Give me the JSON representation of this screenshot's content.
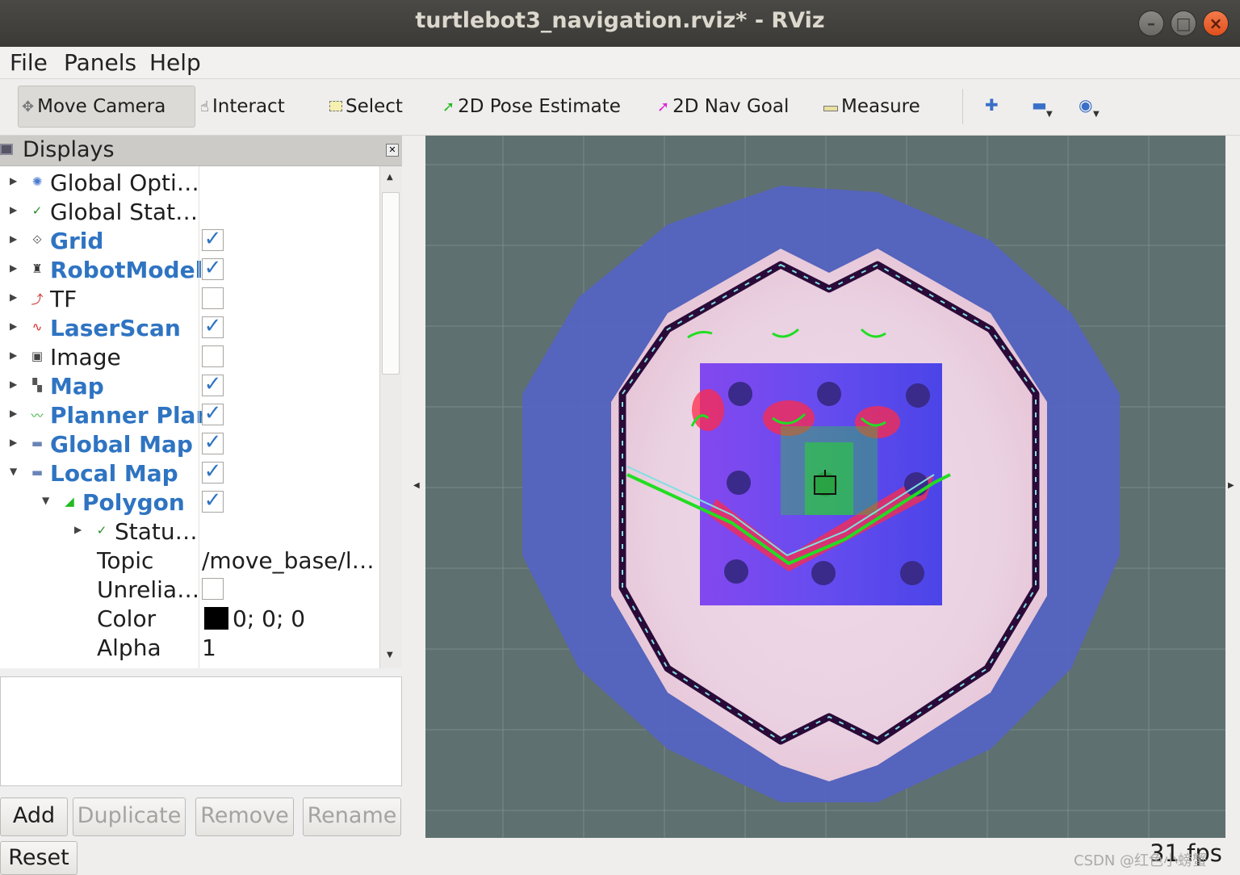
{
  "window": {
    "title": "turtlebot3_navigation.rviz* - RViz"
  },
  "menubar": {
    "file": "File",
    "panels": "Panels",
    "help": "Help"
  },
  "toolbar": {
    "move_camera": "Move Camera",
    "interact": "Interact",
    "select": "Select",
    "pose_estimate": "2D Pose Estimate",
    "nav_goal": "2D Nav Goal",
    "measure": "Measure"
  },
  "displays": {
    "title": "Displays",
    "items": [
      {
        "label": "Global Opti…",
        "icon": "gear-icon",
        "checked": null
      },
      {
        "label": "Global Stat…",
        "icon": "check-icon",
        "checked": null
      },
      {
        "label": "Grid",
        "icon": "grid-icon",
        "checked": true
      },
      {
        "label": "RobotModel",
        "icon": "robot-icon",
        "checked": true
      },
      {
        "label": "TF",
        "icon": "axes-icon",
        "checked": false
      },
      {
        "label": "LaserScan",
        "icon": "laser-icon",
        "checked": true
      },
      {
        "label": "Image",
        "icon": "image-icon",
        "checked": false
      },
      {
        "label": "Map",
        "icon": "map-icon",
        "checked": true
      },
      {
        "label": "Planner Plan",
        "icon": "path-icon",
        "checked": true
      },
      {
        "label": "Global Map",
        "icon": "folder-icon",
        "checked": true
      },
      {
        "label": "Local Map",
        "icon": "folder-icon",
        "checked": true
      },
      {
        "label": "Polygon",
        "icon": "polygon-icon",
        "checked": true
      }
    ],
    "polygon_props": {
      "status": "Statu…",
      "topic_label": "Topic",
      "topic_value": "/move_base/l…",
      "unreliable_label": "Unrelia…",
      "color_label": "Color",
      "color_value": "0; 0; 0",
      "alpha_label": "Alpha",
      "alpha_value": "1"
    }
  },
  "buttons": {
    "add": "Add",
    "duplicate": "Duplicate",
    "remove": "Remove",
    "rename": "Rename",
    "reset": "Reset"
  },
  "status": {
    "fps": "31 fps",
    "watermark": "CSDN @红色小螃蟹"
  },
  "colors": {
    "accent": "#2f74c2",
    "grid_bg": "#5f7070",
    "costmap_low": "#5563c2",
    "costmap_high": "#ff2a4a",
    "path": "#22dd22"
  }
}
